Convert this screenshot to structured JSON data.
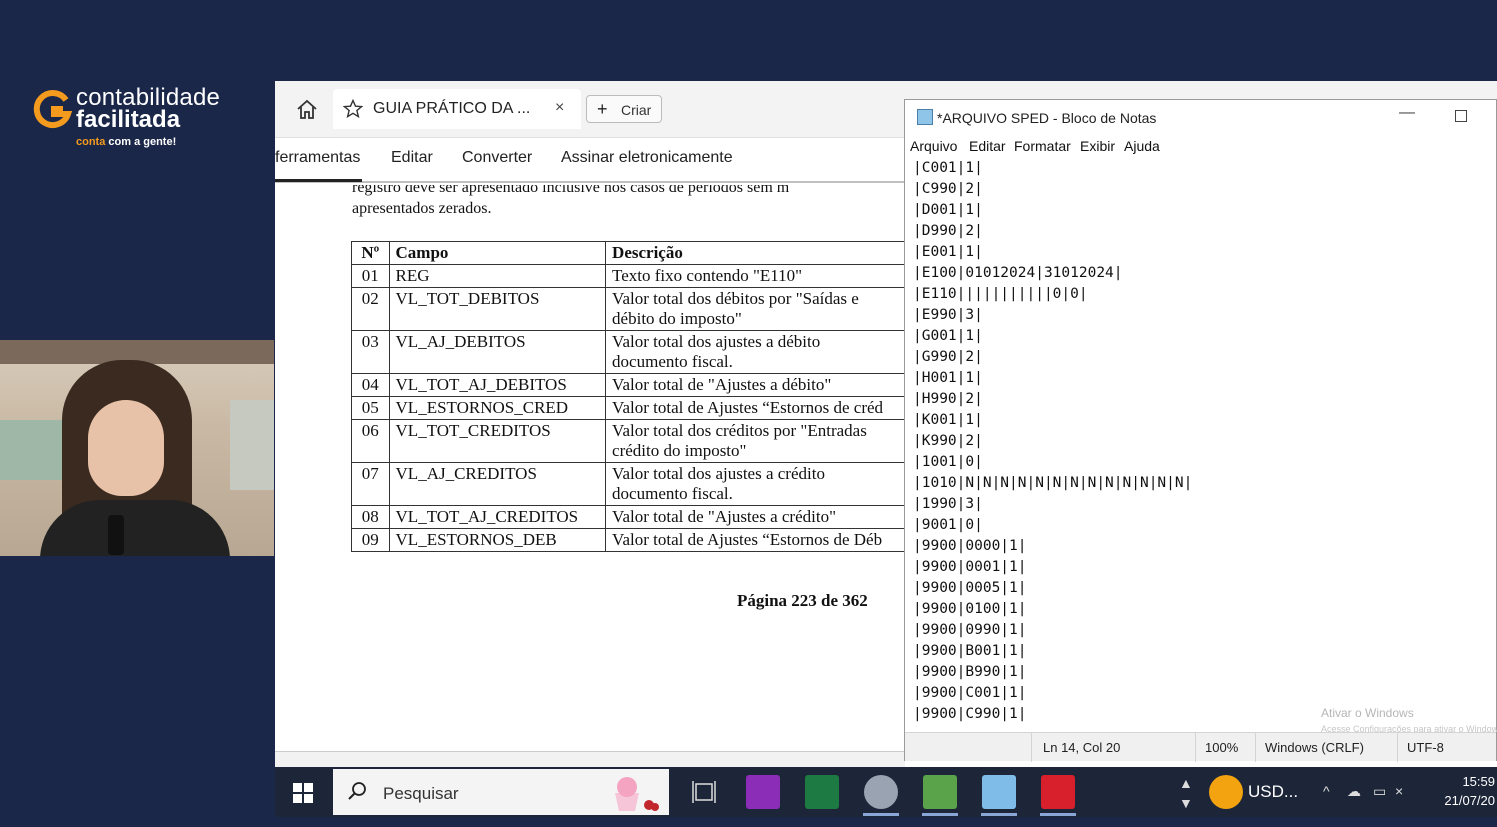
{
  "brand": {
    "name_top": "contabilidade",
    "name_bottom": "facilitada",
    "tagline_accent": "conta",
    "tagline_rest": " com a gente!"
  },
  "pdf_viewer": {
    "tab_title": "GUIA PRÁTICO DA ...",
    "tab_close": "×",
    "create_button": "Criar",
    "toolbar": [
      "ferramentas",
      "Editar",
      "Converter",
      "Assinar eletronicamente"
    ],
    "paragraph_line1": "registro deve ser apresentado inclusive nos casos de períodos sem m",
    "paragraph_line2": "apresentados zerados.",
    "table_headers": [
      "Nº",
      "Campo",
      "Descrição"
    ],
    "table_rows": [
      {
        "n": "01",
        "campo": "REG",
        "desc1": "Texto fixo contendo \"E110\"",
        "desc2": ""
      },
      {
        "n": "02",
        "campo": "VL_TOT_DEBITOS",
        "desc1": "Valor total dos débitos por \"Saídas e",
        "desc2": "débito do imposto\""
      },
      {
        "n": "03",
        "campo": "VL_AJ_DEBITOS",
        "desc1": "Valor total dos ajustes a débito",
        "desc2": "documento fiscal."
      },
      {
        "n": "04",
        "campo": "VL_TOT_AJ_DEBITOS",
        "desc1": "Valor total de \"Ajustes a débito\"",
        "desc2": ""
      },
      {
        "n": "05",
        "campo": "VL_ESTORNOS_CRED",
        "desc1": "Valor total de Ajustes “Estornos de créd",
        "desc2": ""
      },
      {
        "n": "06",
        "campo": "VL_TOT_CREDITOS",
        "desc1": "Valor total dos créditos por \"Entradas",
        "desc2": "crédito do imposto\""
      },
      {
        "n": "07",
        "campo": "VL_AJ_CREDITOS",
        "desc1": "Valor total dos ajustes a crédito",
        "desc2": "documento fiscal."
      },
      {
        "n": "08",
        "campo": "VL_TOT_AJ_CREDITOS",
        "desc1": "Valor total de \"Ajustes a crédito\"",
        "desc2": ""
      },
      {
        "n": "09",
        "campo": "VL_ESTORNOS_DEB",
        "desc1": "Valor total de Ajustes “Estornos de Déb",
        "desc2": ""
      }
    ],
    "page_number": "Página 223 de 362"
  },
  "notepad": {
    "title": "*ARQUIVO SPED - Bloco de Notas",
    "menu": [
      "Arquivo",
      "Editar",
      "Formatar",
      "Exibir",
      "Ajuda"
    ],
    "lines": [
      "|C001|1|",
      "|C990|2|",
      "|D001|1|",
      "|D990|2|",
      "|E001|1|",
      "|E100|01012024|31012024|",
      "|E110|||||||||||0|0|",
      "|E990|3|",
      "|G001|1|",
      "|G990|2|",
      "|H001|1|",
      "|H990|2|",
      "|K001|1|",
      "|K990|2|",
      "|1001|0|",
      "|1010|N|N|N|N|N|N|N|N|N|N|N|N|N|",
      "|1990|3|",
      "|9001|0|",
      "|9900|0000|1|",
      "|9900|0001|1|",
      "|9900|0005|1|",
      "|9900|0100|1|",
      "|9900|0990|1|",
      "|9900|B001|1|",
      "|9900|B990|1|",
      "|9900|C001|1|",
      "|9900|C990|1|"
    ],
    "watermark_title": "Ativar o Windows",
    "watermark_sub": "Acesse Configurações para ativar o Windows.",
    "status_position": "Ln 14, Col 20",
    "status_zoom": "100%",
    "status_eol": "Windows (CRLF)",
    "status_encoding": "UTF-8"
  },
  "taskbar": {
    "search_placeholder": "Pesquisar",
    "tray_label": "USD...",
    "time": "15:59",
    "date": "21/07/20"
  }
}
